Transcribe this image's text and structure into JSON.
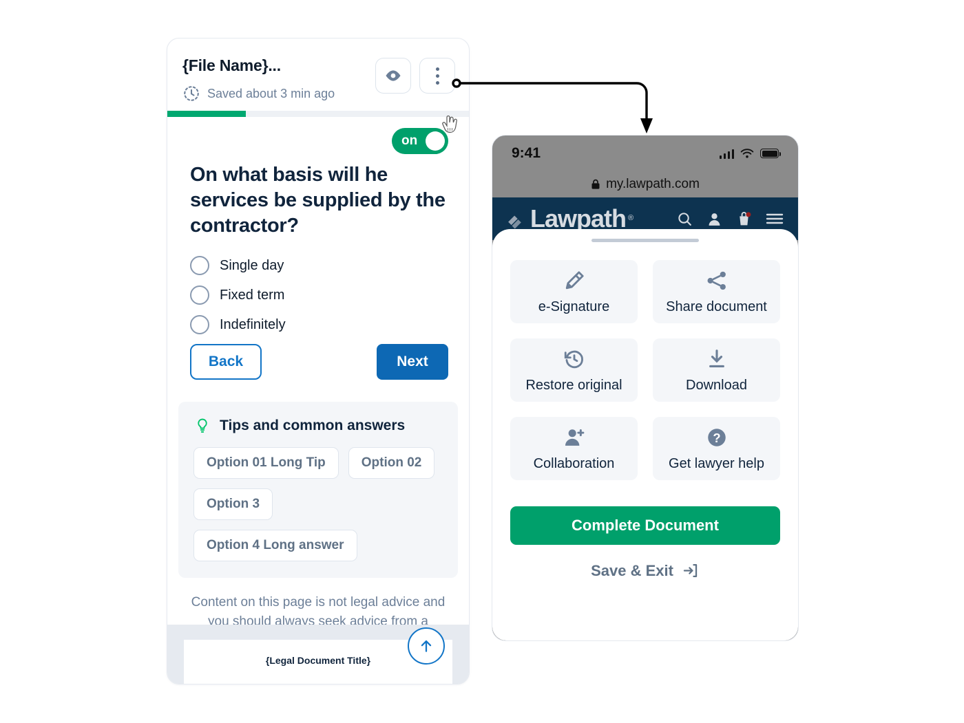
{
  "editor": {
    "file_name": "{File Name}...",
    "saved_status": "Saved about 3 min ago",
    "saved_icon": "clock-icon",
    "preview_icon": "eye-icon",
    "more_icon": "three-dots-vertical-icon",
    "progress_percent": 26,
    "progress_color": "#00a870",
    "toggle": {
      "label": "on",
      "state": "on",
      "color": "#00a06b"
    },
    "question": "On what basis will he services be supplied by the contractor?",
    "options": [
      {
        "label": "Single day",
        "selected": false
      },
      {
        "label": "Fixed term",
        "selected": false
      },
      {
        "label": "Indefinitely",
        "selected": false
      }
    ],
    "back_label": "Back",
    "next_label": "Next",
    "back_color": "#1275c7",
    "next_color": "#0d68b4",
    "tips": {
      "icon": "lightbulb-icon",
      "title": "Tips and common answers",
      "chips": [
        "Option 01 Long  Tip",
        "Option 02",
        "Option 3",
        "Option 4 Long answer"
      ]
    },
    "disclaimer": "Content on this page is not legal advice and you should always seek advice from a qualified professional.",
    "document_title": "{Legal Document Title}",
    "scroll_top_icon": "arrow-up-icon"
  },
  "phone": {
    "status": {
      "time": "9:41",
      "signal_icon": "signal-bars-icon",
      "wifi_icon": "wifi-icon",
      "battery_icon": "battery-full-icon"
    },
    "url": "my.lawpath.com",
    "lock_icon": "lock-icon",
    "nav": {
      "brand": "Lawpath",
      "brand_mark": "registered-trademark",
      "brand_bg": "#0d3350",
      "icons": [
        "search-icon",
        "account-icon",
        "cart-icon",
        "hamburger-menu-icon"
      ],
      "cart_badge_color": "#9b1f1f"
    },
    "sheet": {
      "tiles": [
        {
          "label": "e-Signature",
          "icon": "pencil-edit-icon"
        },
        {
          "label": "Share document",
          "icon": "share-icon"
        },
        {
          "label": "Restore original",
          "icon": "restore-history-icon"
        },
        {
          "label": "Download",
          "icon": "download-icon"
        },
        {
          "label": "Collaboration",
          "icon": "person-add-icon"
        },
        {
          "label": "Get lawyer help",
          "icon": "question-mark-circle-icon"
        }
      ],
      "complete_label": "Complete Document",
      "complete_color": "#00a06b",
      "save_exit_label": "Save & Exit",
      "save_exit_icon": "exit-arrow-icon"
    }
  }
}
